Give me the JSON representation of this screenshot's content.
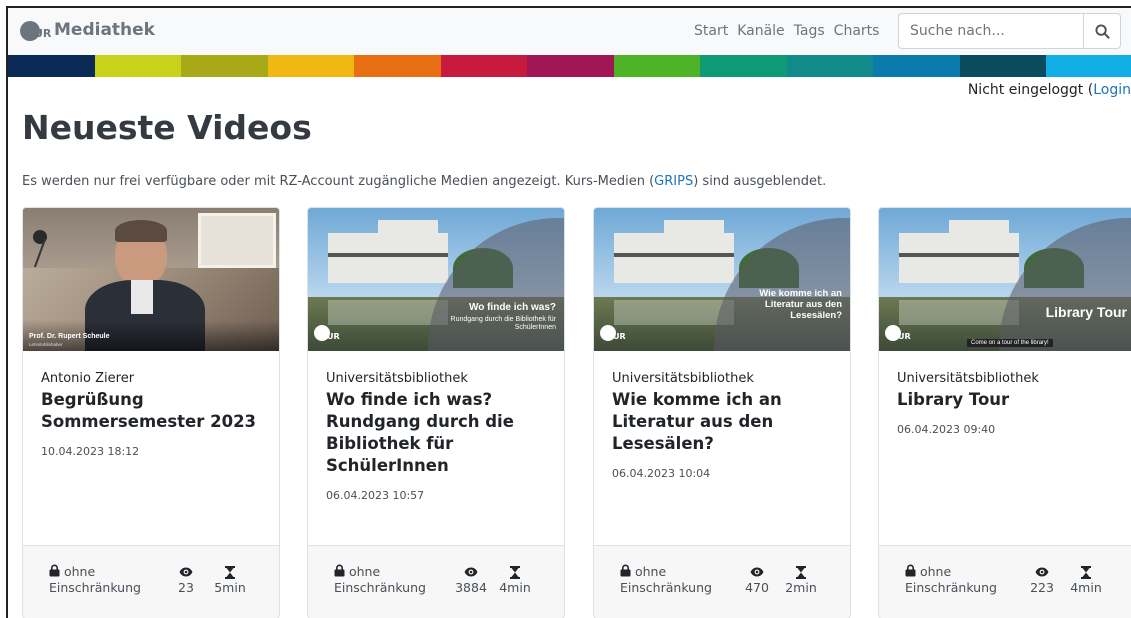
{
  "navbar": {
    "brand": "Mediathek",
    "brand_logo_text": "UR",
    "links": [
      "Start",
      "Kanäle",
      "Tags",
      "Charts"
    ],
    "search_placeholder": "Suche nach..."
  },
  "colorbar": [
    "#0b2a56",
    "#c6d31a",
    "#a7a919",
    "#efb911",
    "#e86f13",
    "#c71a3d",
    "#a11754",
    "#4fb327",
    "#0f9a76",
    "#108b89",
    "#0a7bab",
    "#0a4b5e",
    "#12aee6"
  ],
  "login": {
    "text": "Nicht eingeloggt (",
    "link": "Login"
  },
  "page": {
    "title": "Neueste Videos",
    "notice_prefix": "Es werden nur frei verfügbare oder mit RZ-Account zugängliche Medien angezeigt. Kurs-Medien (",
    "notice_link": "GRIPS",
    "notice_suffix": ") sind ausgeblendet."
  },
  "cards": [
    {
      "author": "Antonio Zierer",
      "title": "Begrüßung Sommersemester 2023",
      "date": "10.04.2023 18:12",
      "access_1": "ohne",
      "access_2": "Einschränkung",
      "views": "23",
      "duration": "5min",
      "thumb_caption": "Prof. Dr. Rupert Scheule",
      "thumb_subcaption": "Lehrstuhlinhaber"
    },
    {
      "author": "Universitätsbibliothek",
      "title": "Wo finde ich was? Rundgang durch die Bibliothek für SchülerInnen",
      "date": "06.04.2023 10:57",
      "access_1": "ohne",
      "access_2": "Einschränkung",
      "views": "3884",
      "duration": "4min",
      "thumb_caption": "Wo finde ich was?",
      "thumb_subcaption": "Rundgang durch die Bibliothek für SchülerInnen"
    },
    {
      "author": "Universitätsbibliothek",
      "title": "Wie komme ich an Literatur aus den Lesesälen?",
      "date": "06.04.2023 10:04",
      "access_1": "ohne",
      "access_2": "Einschränkung",
      "views": "470",
      "duration": "2min",
      "thumb_caption": "Wie komme ich an Literatur aus den Lesesälen?"
    },
    {
      "author": "Universitätsbibliothek",
      "title": "Library Tour",
      "date": "06.04.2023 09:40",
      "access_1": "ohne",
      "access_2": "Einschränkung",
      "views": "223",
      "duration": "4min",
      "thumb_caption": "Library Tour",
      "thumb_subcaption": "Come on a tour of the library!"
    }
  ],
  "icons": {
    "brand": "ur-logo-icon",
    "search": "search-icon",
    "access": "lock-icon",
    "views": "eye-icon",
    "duration": "hourglass-icon"
  }
}
